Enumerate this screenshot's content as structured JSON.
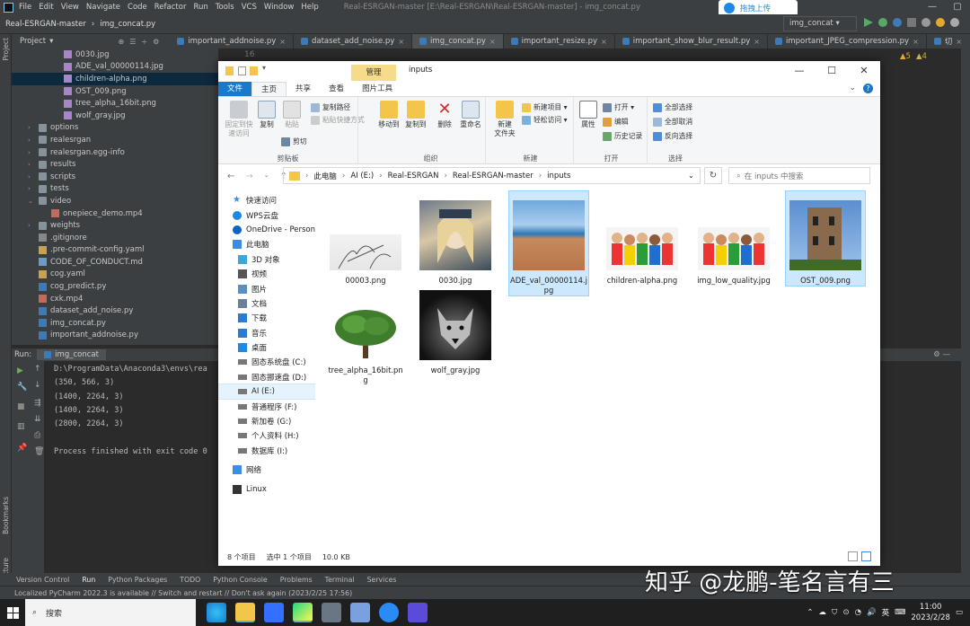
{
  "ide": {
    "menu": [
      "File",
      "Edit",
      "View",
      "Navigate",
      "Code",
      "Refactor",
      "Run",
      "Tools",
      "VCS",
      "Window",
      "Help"
    ],
    "window_title": "Real-ESRGAN-master [E:\\Real-ESRGAN\\Real-ESRGAN-master] - img_concat.py",
    "nav_project": "Real-ESRGAN-master",
    "nav_file": "img_concat.py",
    "run_config": "img_concat",
    "baidu_label": "拖拽上传",
    "project_header": "Project",
    "editor_tabs": [
      "important_addnoise.py",
      "dataset_add_noise.py",
      "img_concat.py",
      "important_resize.py",
      "important_show_blur_result.py",
      "important_JPEG_compression.py",
      "切"
    ],
    "line_number": "16",
    "warnings": "▲5",
    "weak_warnings": "▲4",
    "tree": [
      {
        "label": "0030.jpg",
        "type": "img",
        "indent": 3
      },
      {
        "label": "ADE_val_00000114.jpg",
        "type": "img",
        "indent": 3
      },
      {
        "label": "children-alpha.png",
        "type": "img",
        "indent": 3,
        "selected": true
      },
      {
        "label": "OST_009.png",
        "type": "img",
        "indent": 3
      },
      {
        "label": "tree_alpha_16bit.png",
        "type": "img",
        "indent": 3
      },
      {
        "label": "wolf_gray.jpg",
        "type": "img",
        "indent": 3
      },
      {
        "label": "options",
        "type": "folder",
        "indent": 1,
        "arrow": "›"
      },
      {
        "label": "realesrgan",
        "type": "folder",
        "indent": 1,
        "arrow": "›"
      },
      {
        "label": "realesrgan.egg-info",
        "type": "folder",
        "indent": 1,
        "arrow": "›"
      },
      {
        "label": "results",
        "type": "folder",
        "indent": 1,
        "arrow": "›"
      },
      {
        "label": "scripts",
        "type": "folder",
        "indent": 1,
        "arrow": "›"
      },
      {
        "label": "tests",
        "type": "folder",
        "indent": 1,
        "arrow": "›"
      },
      {
        "label": "video",
        "type": "folder",
        "indent": 1,
        "arrow": "⌄"
      },
      {
        "label": "onepiece_demo.mp4",
        "type": "mp4",
        "indent": 2
      },
      {
        "label": "weights",
        "type": "folder",
        "indent": 1,
        "arrow": "›"
      },
      {
        "label": ".gitignore",
        "type": "txt",
        "indent": 1
      },
      {
        "label": ".pre-commit-config.yaml",
        "type": "yml",
        "indent": 1
      },
      {
        "label": "CODE_OF_CONDUCT.md",
        "type": "md",
        "indent": 1
      },
      {
        "label": "cog.yaml",
        "type": "yml",
        "indent": 1
      },
      {
        "label": "cog_predict.py",
        "type": "py",
        "indent": 1
      },
      {
        "label": "cxk.mp4",
        "type": "mp4",
        "indent": 1
      },
      {
        "label": "dataset_add_noise.py",
        "type": "py",
        "indent": 1
      },
      {
        "label": "img_concat.py",
        "type": "py",
        "indent": 1
      },
      {
        "label": "important_addnoise.py",
        "type": "py",
        "indent": 1
      }
    ],
    "run_label": "Run:",
    "run_tab": "img_concat",
    "console": "D:\\ProgramData\\Anaconda3\\envs\\rea\n(350, 566, 3)\n(1400, 2264, 3)\n(1400, 2264, 3)\n(2800, 2264, 3)\n\nProcess finished with exit code 0",
    "bottom_tools": [
      "Version Control",
      "Run",
      "Python Packages",
      "TODO",
      "Python Console",
      "Problems",
      "Terminal",
      "Services"
    ],
    "status": "Localized PyCharm 2022.3 is available // Switch and restart // Don't ask again (2023/2/25 17:56)",
    "side_labels": [
      "Project",
      "Bookmarks",
      "Structure"
    ]
  },
  "explorer": {
    "manage_tab": "管理",
    "title": "inputs",
    "tabs": [
      "文件",
      "主页",
      "共享",
      "查看",
      "图片工具"
    ],
    "ribbon": {
      "clipboard": {
        "label": "剪贴板",
        "pin": "固定到快速访问",
        "copy": "复制",
        "paste": "粘贴",
        "copy_path": "复制路径",
        "paste_shortcut": "粘贴快捷方式",
        "cut": "剪切"
      },
      "organize": {
        "label": "组织",
        "move_to": "移动到",
        "copy_to": "复制到",
        "delete": "删除",
        "rename": "重命名"
      },
      "new": {
        "label": "新建",
        "new_folder": "新建\n文件夹",
        "new_item": "新建项目 ▾",
        "easy_access": "轻松访问 ▾"
      },
      "open": {
        "label": "打开",
        "properties": "属性",
        "open": "打开 ▾",
        "edit": "编辑",
        "history": "历史记录"
      },
      "select": {
        "label": "选择",
        "select_all": "全部选择",
        "select_none": "全部取消",
        "invert": "反向选择"
      }
    },
    "path": [
      "此电脑",
      "AI (E:)",
      "Real-ESRGAN",
      "Real-ESRGAN-master",
      "inputs"
    ],
    "search_placeholder": "在 inputs 中搜索",
    "nav": [
      {
        "label": "快速访问",
        "icon": "star",
        "color": "#3a8ee6",
        "indent": 0
      },
      {
        "label": "WPS云盘",
        "icon": "cloud",
        "color": "#1e88e5",
        "indent": 0
      },
      {
        "label": "OneDrive - Personal",
        "icon": "cloud",
        "color": "#0a64c8",
        "indent": 0
      },
      {
        "label": "此电脑",
        "icon": "pc",
        "color": "#3a8ee6",
        "indent": 0
      },
      {
        "label": "3D 对象",
        "icon": "3d",
        "color": "#3da5d9",
        "indent": 1
      },
      {
        "label": "视频",
        "icon": "video",
        "color": "#555",
        "indent": 1
      },
      {
        "label": "图片",
        "icon": "pic",
        "color": "#5a8fc0",
        "indent": 1
      },
      {
        "label": "文档",
        "icon": "doc",
        "color": "#6a7f99",
        "indent": 1
      },
      {
        "label": "下载",
        "icon": "down",
        "color": "#2b7bd4",
        "indent": 1
      },
      {
        "label": "音乐",
        "icon": "music",
        "color": "#2b7bd4",
        "indent": 1
      },
      {
        "label": "桌面",
        "icon": "desk",
        "color": "#1e88e5",
        "indent": 1
      },
      {
        "label": "固态系统盘 (C:)",
        "icon": "drive",
        "color": "#777",
        "indent": 1
      },
      {
        "label": "固态挪速盘 (D:)",
        "icon": "drive",
        "color": "#777",
        "indent": 1
      },
      {
        "label": "AI (E:)",
        "icon": "drive",
        "color": "#777",
        "indent": 1,
        "selected": true
      },
      {
        "label": "普通程序 (F:)",
        "icon": "drive",
        "color": "#777",
        "indent": 1
      },
      {
        "label": "新加卷 (G:)",
        "icon": "drive",
        "color": "#777",
        "indent": 1
      },
      {
        "label": "个人资料 (H:)",
        "icon": "drive",
        "color": "#777",
        "indent": 1
      },
      {
        "label": "数据库 (I:)",
        "icon": "drive",
        "color": "#777",
        "indent": 1
      },
      {
        "label": "网络",
        "icon": "net",
        "color": "#3a8ee6",
        "indent": 0,
        "gap": true
      },
      {
        "label": "Linux",
        "icon": "linux",
        "color": "#333",
        "indent": 0,
        "gap": true
      }
    ],
    "files": [
      {
        "name": "00003.png",
        "kind": "sketch"
      },
      {
        "name": "0030.jpg",
        "kind": "anime"
      },
      {
        "name": "ADE_val_00000114.jpg",
        "kind": "beach",
        "selected": true
      },
      {
        "name": "children-alpha.png",
        "kind": "children"
      },
      {
        "name": "img_low_quality.jpg",
        "kind": "children"
      },
      {
        "name": "OST_009.png",
        "kind": "tower",
        "selected": true
      },
      {
        "name": "tree_alpha_16bit.png",
        "kind": "tree"
      },
      {
        "name": "wolf_gray.jpg",
        "kind": "wolf"
      }
    ],
    "status_count": "8 个项目",
    "status_selected": "选中 1 个项目",
    "status_size": "10.0 KB"
  },
  "taskbar": {
    "search": "搜索",
    "ime": "英",
    "time": "11:00",
    "date": "2023/2/28"
  },
  "watermark": "知乎 @龙鹏-笔名言有三"
}
